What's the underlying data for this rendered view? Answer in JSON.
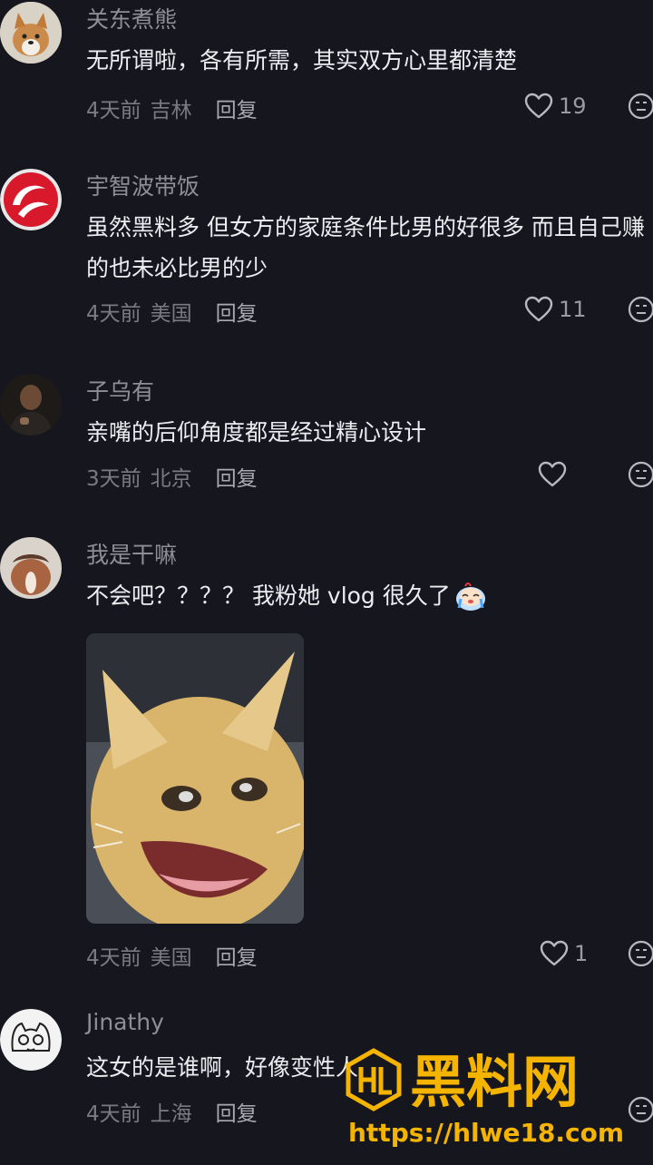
{
  "comments": [
    {
      "username": "关东煮熊",
      "text": "无所谓啦，各有所需，其实双方心里都清楚",
      "time": "4天前",
      "location": "吉林",
      "reply": "回复",
      "likes": "19"
    },
    {
      "username": "宇智波带饭",
      "text": "虽然黑料多 但女方的家庭条件比男的好很多 而且自己赚的也未必比男的少",
      "time": "4天前",
      "location": "美国",
      "reply": "回复",
      "likes": "11"
    },
    {
      "username": "子乌有",
      "text": "亲嘴的后仰角度都是经过精心设计",
      "time": "3天前",
      "location": "北京",
      "reply": "回复",
      "likes": ""
    },
    {
      "username": "我是干嘛",
      "text": "不会吧？？？？ 我粉她 vlog 很久了",
      "time": "4天前",
      "location": "美国",
      "reply": "回复",
      "likes": "1"
    },
    {
      "username": "Jinathy",
      "text": "这女的是谁啊，好像变性人",
      "time": "4天前",
      "location": "上海",
      "reply": "回复",
      "likes": ""
    }
  ],
  "watermark": {
    "brand": "黑料网",
    "url": "https://hlwe18.com"
  },
  "colors": {
    "background": "#16161e",
    "username": "#8e8e96",
    "text": "#ecedf0",
    "meta": "#7a7a82",
    "watermark": "#f5b400"
  }
}
